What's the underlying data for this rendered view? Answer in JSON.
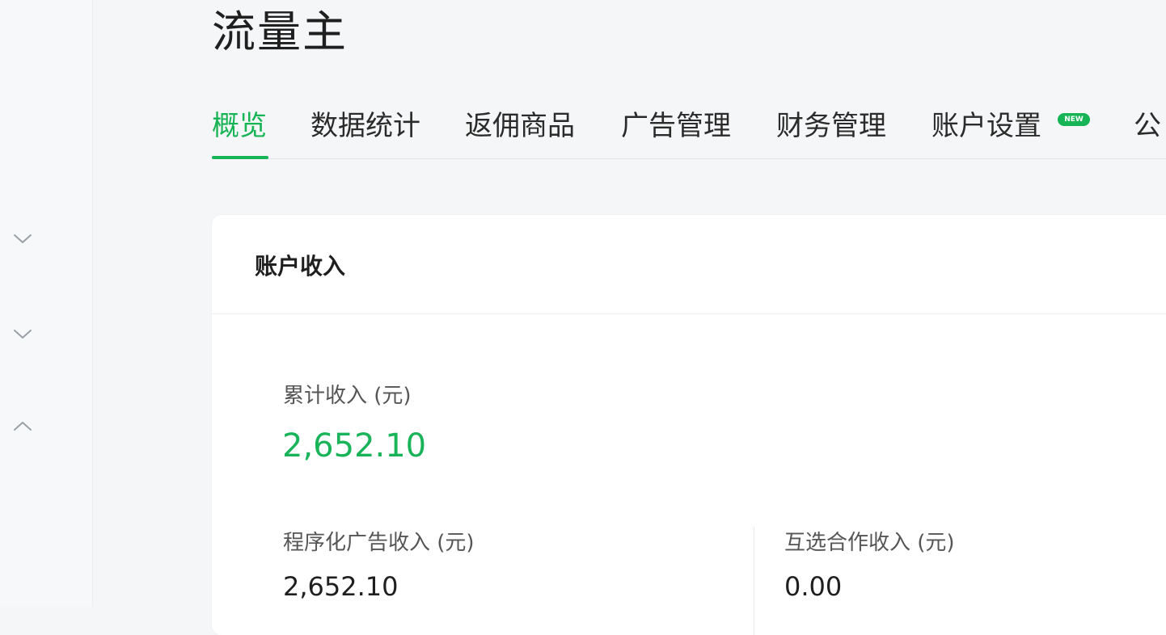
{
  "header": {
    "title": "流量主"
  },
  "tabs": [
    {
      "label": "概览",
      "active": true
    },
    {
      "label": "数据统计",
      "active": false
    },
    {
      "label": "返佣商品",
      "active": false
    },
    {
      "label": "广告管理",
      "active": false
    },
    {
      "label": "财务管理",
      "active": false
    },
    {
      "label": "账户设置",
      "active": false,
      "badge": "NEW"
    },
    {
      "label": "公",
      "active": false
    }
  ],
  "sidebar": {
    "icons": [
      {
        "name": "chevron-down-icon"
      },
      {
        "name": "chevron-down-icon"
      },
      {
        "name": "chevron-up-icon"
      }
    ]
  },
  "account_income": {
    "title": "账户收入",
    "total_label": "累计收入 (元)",
    "total_value": "2,652.10",
    "programmatic_label": "程序化广告收入 (元)",
    "programmatic_value": "2,652.10",
    "mutual_label": "互选合作收入 (元)",
    "mutual_value": "0.00"
  },
  "colors": {
    "accent": "#16b455",
    "text": "#1f1f1f",
    "muted": "#555555",
    "background": "#f5f6f7"
  }
}
